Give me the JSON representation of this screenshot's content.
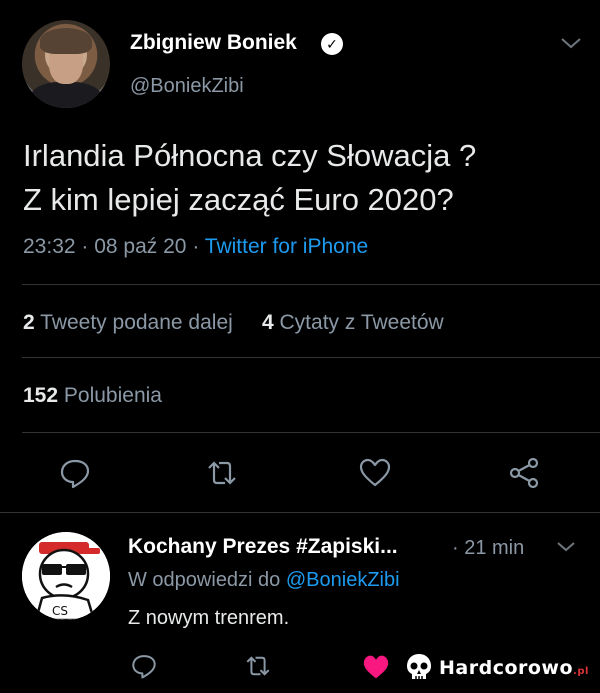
{
  "tweet": {
    "author_name": "Zbigniew Boniek",
    "author_handle": "@BoniekZibi",
    "text_line1": "Irlandia Północna czy Słowacja ?",
    "text_line2": "Z kim lepiej zacząć Euro 2020?",
    "time": "23:32",
    "date": "08 paź 20",
    "source": "Twitter for iPhone",
    "retweets_count": "2",
    "retweets_label": "Tweety podane dalej",
    "quotes_count": "4",
    "quotes_label": "Cytaty z Tweetów",
    "likes_count": "152",
    "likes_label": "Polubienia"
  },
  "reply": {
    "author_name": "Kochany Prezes #Zapiski...",
    "time": "· 21 min",
    "replying_prefix": "W odpowiedzi do",
    "replying_handle": "@BoniekZibi",
    "text": "Z nowym trenrem."
  },
  "watermark": {
    "text": "Hardcorowo",
    "suffix": ".pl"
  },
  "icons": {
    "reply": "speech-bubble-icon",
    "retweet": "retweet-icon",
    "like": "heart-icon",
    "share": "share-icon",
    "verified": "verified-badge-icon",
    "more": "chevron-down-icon"
  },
  "colors": {
    "background": "#000000",
    "link": "#1d9bf0",
    "muted": "#8b98a5",
    "like_active": "#f91880"
  }
}
